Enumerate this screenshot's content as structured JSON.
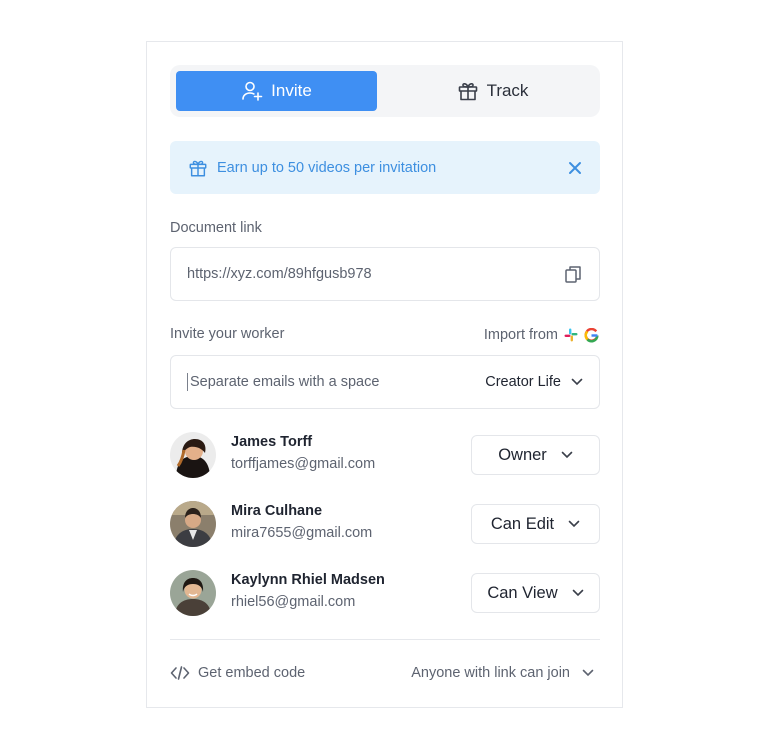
{
  "tabs": {
    "invite_label": "Invite",
    "track_label": "Track",
    "active": "Invite"
  },
  "banner": {
    "text": "Earn up to 50 videos per invitation",
    "icon": "gift-icon"
  },
  "document": {
    "label": "Document link",
    "url": "https://xyz.com/89hfgusb978",
    "copy_icon": "copy-icon"
  },
  "invite": {
    "label": "Invite your worker",
    "import_label": "Import from",
    "import_sources": [
      "slack-icon",
      "google-icon"
    ],
    "email_placeholder": "Separate emails with a space",
    "space_value": "Creator Life"
  },
  "members": [
    {
      "name": "James Torff",
      "email": "torffjames@gmail.com",
      "role": "Owner"
    },
    {
      "name": "Mira Culhane",
      "email": "mira7655@gmail.com",
      "role": "Can Edit"
    },
    {
      "name": "Kaylynn Rhiel Madsen",
      "email": "rhiel56@gmail.com",
      "role": "Can View"
    }
  ],
  "footer": {
    "embed_label": "Get embed code",
    "access_value": "Anyone with link can join"
  },
  "colors": {
    "accent": "#3f8ff3",
    "banner_bg": "#e6f3fc",
    "banner_text": "#3d8fe0"
  }
}
